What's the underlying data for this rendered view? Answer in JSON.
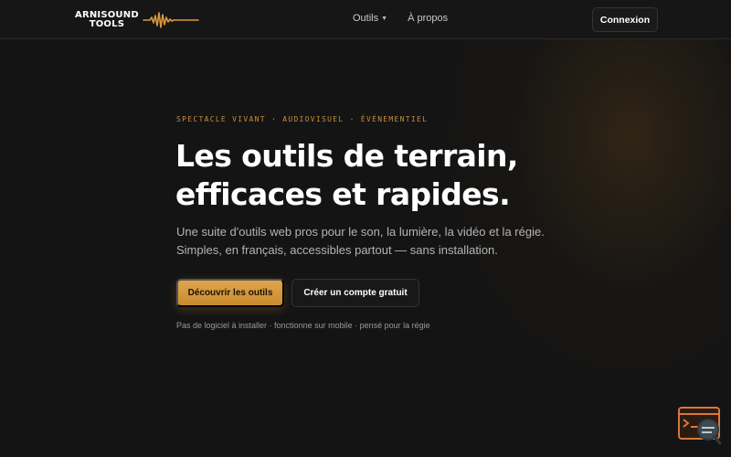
{
  "brand": {
    "logo_line1": "ARNISOUND",
    "logo_line2": "TOOLS",
    "accent_color": "#d89a3e"
  },
  "nav": {
    "tools_label": "Outils",
    "about_label": "À propos",
    "login_label": "Connexion"
  },
  "hero": {
    "kicker": "SPECTACLE VIVANT · AUDIOVISUEL · ÉVÉNEMENTIEL",
    "title_line1": "Les outils de terrain,",
    "title_line2": "efficaces et rapides.",
    "subtitle": "Une suite d'outils web pros pour le son, la lumière, la vidéo et la régie. Simples, en français, accessibles partout — sans installation.",
    "primary_cta": "Découvrir les outils",
    "secondary_cta": "Créer un compte gratuit",
    "note": "Pas de logiciel à installer · fonctionne sur mobile · pensé pour la régie"
  },
  "icons": {
    "logo_wave": "sound-wave-icon",
    "tools_caret": "chevron-down-icon",
    "widget": "terminal-search-icon"
  }
}
